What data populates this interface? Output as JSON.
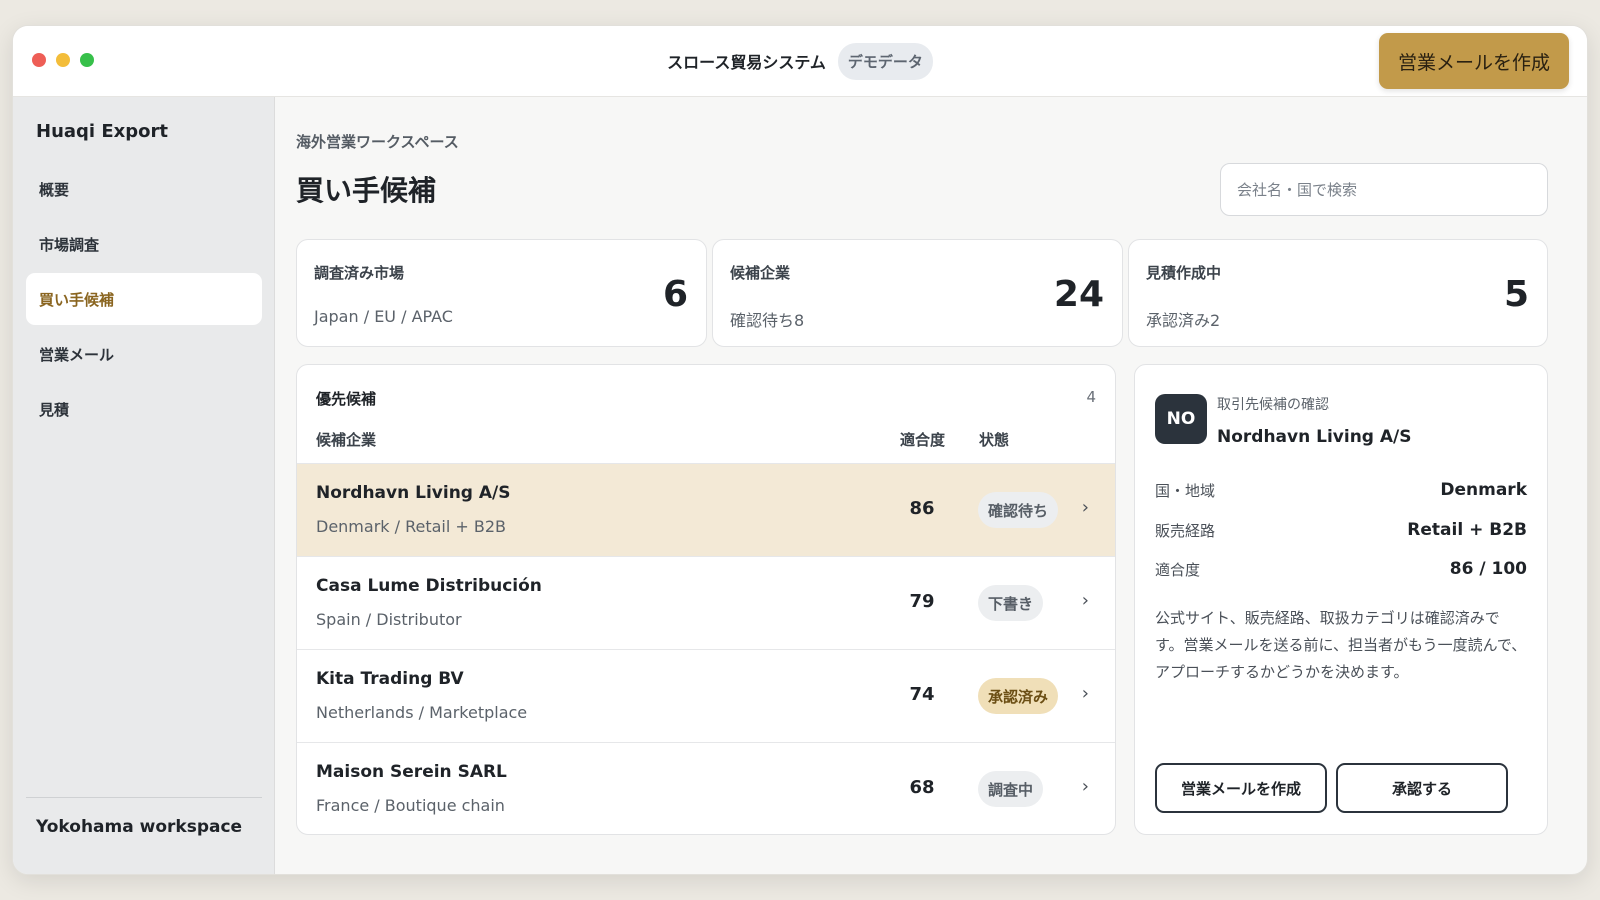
{
  "titlebar": {
    "title": "スロース貿易システム",
    "badge": "デモデータ",
    "cta_label": "営業メールを作成"
  },
  "sidebar": {
    "brand": "Huaqi Export",
    "items": [
      {
        "label": "概要",
        "active": false
      },
      {
        "label": "市場調査",
        "active": false
      },
      {
        "label": "買い手候補",
        "active": true
      },
      {
        "label": "営業メール",
        "active": false
      },
      {
        "label": "見積",
        "active": false
      }
    ],
    "workspace": "Yokohama workspace"
  },
  "header": {
    "eyebrow": "海外営業ワークスペース",
    "title": "買い手候補",
    "search_placeholder": "会社名・国で検索"
  },
  "stats": [
    {
      "label": "調査済み市場",
      "sub": "Japan / EU / APAC",
      "value": "6"
    },
    {
      "label": "候補企業",
      "sub": "確認待ち8",
      "value": "24"
    },
    {
      "label": "見積作成中",
      "sub": "承認済み2",
      "value": "5"
    }
  ],
  "table": {
    "title": "優先候補",
    "count": "4",
    "columns": {
      "company": "候補企業",
      "fit": "適合度",
      "status": "状態"
    },
    "rows": [
      {
        "name": "Nordhavn Living A/S",
        "meta": "Denmark / Retail + B2B",
        "fit": "86",
        "status": "確認待ち",
        "selected": true
      },
      {
        "name": "Casa Lume Distribución",
        "meta": "Spain / Distributor",
        "fit": "79",
        "status": "下書き",
        "selected": false
      },
      {
        "name": "Kita Trading BV",
        "meta": "Netherlands / Marketplace",
        "fit": "74",
        "status": "承認済み",
        "selected": false
      },
      {
        "name": "Maison Serein SARL",
        "meta": "France / Boutique chain",
        "fit": "68",
        "status": "調査中",
        "selected": false
      }
    ]
  },
  "detail": {
    "avatar": "NO",
    "eyebrow": "取引先候補の確認",
    "name": "Nordhavn Living A/S",
    "fields": [
      {
        "label": "国・地域",
        "value": "Denmark"
      },
      {
        "label": "販売経路",
        "value": "Retail + B2B"
      },
      {
        "label": "適合度",
        "value": "86 / 100"
      }
    ],
    "note": "公式サイト、販売経路、取扱カテゴリは確認済みです。営業メールを送る前に、担当者がもう一度読んで、アプローチするかどうかを決めます。",
    "email_button": "営業メールを作成",
    "approve_button": "承認する"
  },
  "colors": {
    "accent": "#c29a4a",
    "selected_row": "#f3e9d6",
    "approved_pill": "#f0dfb8",
    "avatar_bg": "#2b333c"
  },
  "icons": {
    "row_chevron": "chevron-right-icon",
    "chevron_glyph": "›"
  }
}
